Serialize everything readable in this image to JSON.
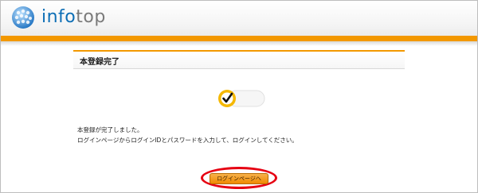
{
  "header": {
    "brand_info": "info",
    "brand_top": "top",
    "logo_icon": "infotop-sphere-icon"
  },
  "panel": {
    "title": "本登録完了"
  },
  "badge": {
    "icon": "checkmark-seal-icon"
  },
  "message": {
    "line1": "本登録が完了しました。",
    "line2": "ログインページからログインIDとパスワードを入力して、ログインしてください。"
  },
  "button": {
    "label": "ログインページへ"
  },
  "colors": {
    "accent": "#f39800",
    "brand_blue": "#0e6fb6",
    "highlight_ring": "#e60012"
  }
}
